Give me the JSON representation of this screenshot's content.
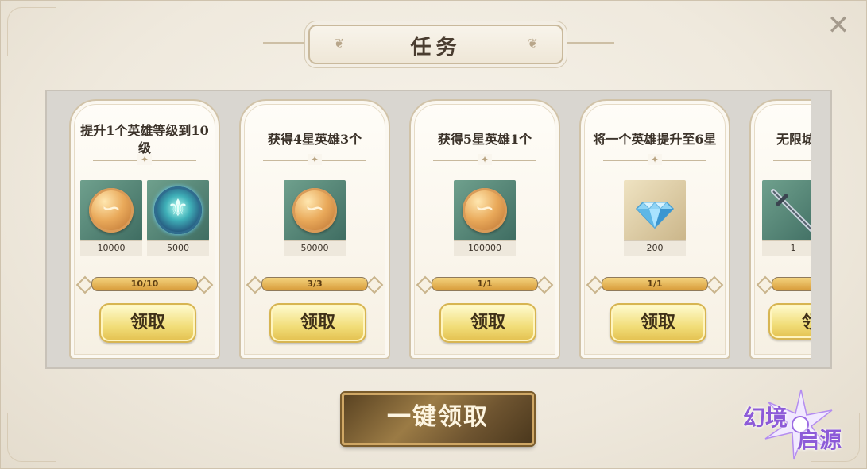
{
  "header": {
    "title": "任务",
    "close_icon": "close-icon"
  },
  "tasks": [
    {
      "title": "提升1个英雄等级到10级",
      "rewards": [
        {
          "icon": "gold-coin-icon",
          "qty": "10000"
        },
        {
          "icon": "spirit-orb-icon",
          "qty": "5000"
        }
      ],
      "progress_text": "10/10",
      "progress": 1.0,
      "claim_label": "领取"
    },
    {
      "title": "获得4星英雄3个",
      "rewards": [
        {
          "icon": "gold-coin-icon",
          "qty": "50000"
        }
      ],
      "progress_text": "3/3",
      "progress": 1.0,
      "claim_label": "领取"
    },
    {
      "title": "获得5星英雄1个",
      "rewards": [
        {
          "icon": "gold-coin-icon",
          "qty": "100000"
        }
      ],
      "progress_text": "1/1",
      "progress": 1.0,
      "claim_label": "领取"
    },
    {
      "title": "将一个英雄提升至6星",
      "rewards": [
        {
          "icon": "diamond-icon",
          "qty": "200"
        }
      ],
      "progress_text": "1/1",
      "progress": 1.0,
      "claim_label": "领取"
    },
    {
      "title": "无限城",
      "rewards": [
        {
          "icon": "sword-icon",
          "qty": "1"
        }
      ],
      "progress_text": "",
      "progress": 1.0,
      "claim_label": "领"
    }
  ],
  "footer": {
    "claim_all_label": "一键领取"
  },
  "logo": {
    "line1": "幻境",
    "line2": "启源",
    "tagline": ""
  },
  "colors": {
    "accent_gold": "#e3c04f",
    "progress_fill": "#d89c3a",
    "logo_purple": "#8d5bd8"
  }
}
